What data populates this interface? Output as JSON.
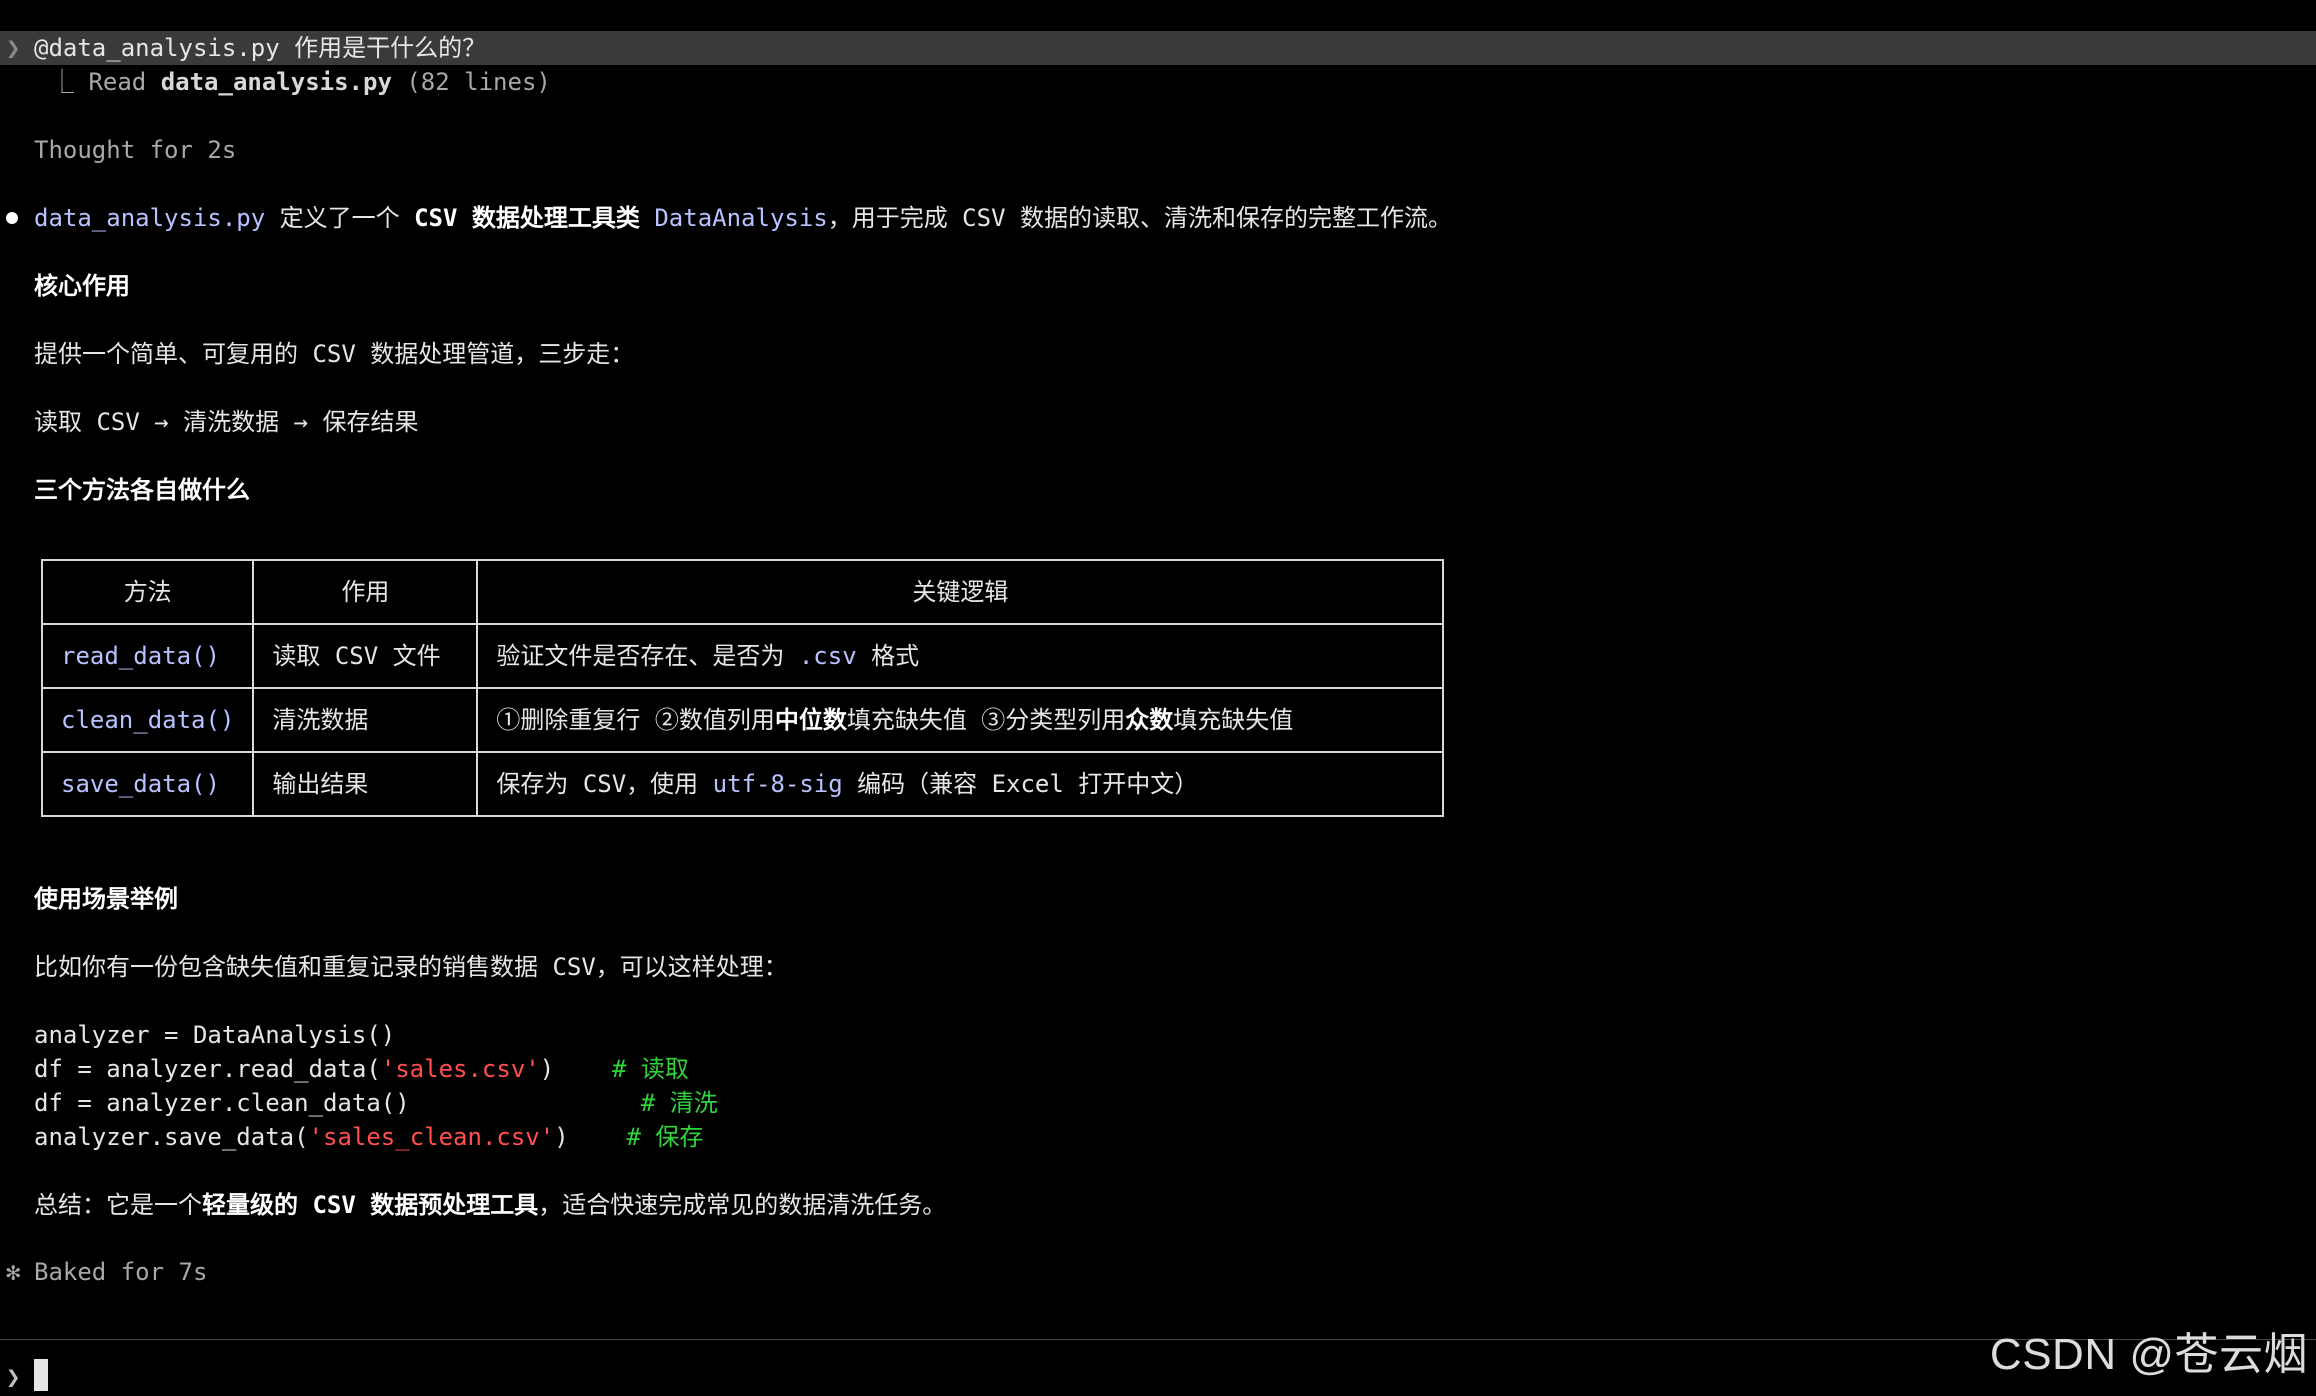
{
  "prompt": {
    "caret": "❯",
    "text": "@data_analysis.py 作用是干什么的？"
  },
  "read_line": {
    "branch": "⎿",
    "verb": "Read",
    "file": "data_analysis.py",
    "count": "(82 lines)"
  },
  "thought": "Thought for 2s",
  "summary": {
    "file": "data_analysis.py",
    "t1": " 定义了一个 ",
    "b1": "CSV 数据处理工具类",
    "t2": " ",
    "cls": "DataAnalysis",
    "t3": "，用于完成 CSV 数据的读取、清洗和保存的完整工作流。"
  },
  "section1": {
    "heading": "核心作用",
    "desc": "提供一个简单、可复用的 CSV 数据处理管道，三步走：",
    "flow": "读取 CSV → 清洗数据 → 保存结果"
  },
  "section2": {
    "heading": "三个方法各自做什么"
  },
  "table": {
    "headers": [
      "方法",
      "作用",
      "关键逻辑"
    ],
    "rows": [
      {
        "method": "read_data()",
        "role": "读取 CSV 文件",
        "logic_a": "验证文件是否存在、是否为 ",
        "logic_code": ".csv",
        "logic_b": " 格式"
      },
      {
        "method": "clean_data()",
        "role": "清洗数据",
        "logic_a": "①删除重复行 ②数值列用",
        "logic_bold1": "中位数",
        "logic_b": "填充缺失值 ③分类型列用",
        "logic_bold2": "众数",
        "logic_c": "填充缺失值"
      },
      {
        "method": "save_data()",
        "role": "输出结果",
        "logic_a": "保存为 CSV，使用 ",
        "logic_code": "utf-8-sig",
        "logic_b": " 编码（兼容 Excel 打开中文）"
      }
    ]
  },
  "section3": {
    "heading": "使用场景举例",
    "desc": "比如你有一份包含缺失值和重复记录的销售数据 CSV，可以这样处理："
  },
  "code": [
    {
      "pre": "analyzer = DataAnalysis()",
      "str": "",
      "post": "",
      "comment": ""
    },
    {
      "pre": "df = analyzer.read_data(",
      "str": "'sales.csv'",
      "post": ")    ",
      "comment": "# 读取"
    },
    {
      "pre": "df = analyzer.clean_data()                ",
      "str": "",
      "post": "",
      "comment": "# 清洗"
    },
    {
      "pre": "analyzer.save_data(",
      "str": "'sales_clean.csv'",
      "post": ")    ",
      "comment": "# 保存"
    }
  ],
  "conclusion": {
    "a": "总结：它是一个",
    "b": "轻量级的 CSV 数据预处理工具",
    "c": "，适合快速完成常见的数据清洗任务。"
  },
  "baked": {
    "star": "✻",
    "text": "Baked for 7s"
  },
  "input": {
    "caret": "❯"
  },
  "watermark": "CSDN @苍云烟",
  "colors": {
    "background": "#000000",
    "prompt_bar": "#3a3a3a",
    "code_identifier": "#b8c2ff",
    "string": "#ff4f4f",
    "comment": "#2fd33a"
  }
}
